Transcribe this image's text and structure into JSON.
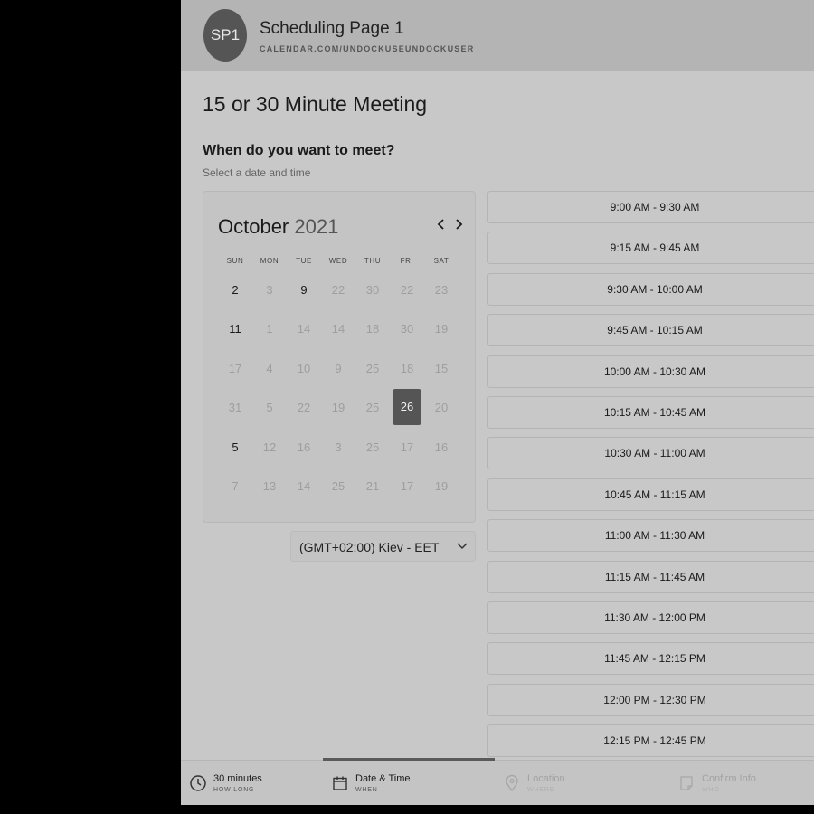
{
  "header": {
    "avatar_initials": "SP1",
    "title": "Scheduling Page 1",
    "url": "CALENDAR.COM/UNDOCKUSEUNDOCKUSER"
  },
  "meeting_title": "15 or 30 Minute Meeting",
  "question": "When do you want to meet?",
  "subtitle": "Select a date and time",
  "calendar": {
    "month": "October",
    "year": "2021",
    "weekdays": [
      "SUN",
      "MON",
      "TUE",
      "WED",
      "THU",
      "FRI",
      "SAT"
    ],
    "weeks": [
      [
        {
          "d": "2",
          "on": true
        },
        {
          "d": "3"
        },
        {
          "d": "9",
          "on": true
        },
        {
          "d": "22"
        },
        {
          "d": "30"
        },
        {
          "d": "22"
        },
        {
          "d": "23"
        }
      ],
      [
        {
          "d": "11",
          "on": true
        },
        {
          "d": "1"
        },
        {
          "d": "14"
        },
        {
          "d": "14"
        },
        {
          "d": "18"
        },
        {
          "d": "30"
        },
        {
          "d": "19"
        }
      ],
      [
        {
          "d": "17"
        },
        {
          "d": "4"
        },
        {
          "d": "10"
        },
        {
          "d": "9"
        },
        {
          "d": "25"
        },
        {
          "d": "18"
        },
        {
          "d": "15"
        }
      ],
      [
        {
          "d": "31"
        },
        {
          "d": "5"
        },
        {
          "d": "22"
        },
        {
          "d": "19"
        },
        {
          "d": "25"
        },
        {
          "d": "26",
          "sel": true
        },
        {
          "d": "20"
        }
      ],
      [
        {
          "d": "5",
          "on": true
        },
        {
          "d": "12"
        },
        {
          "d": "16"
        },
        {
          "d": "3"
        },
        {
          "d": "25"
        },
        {
          "d": "17"
        },
        {
          "d": "16"
        }
      ],
      [
        {
          "d": "7"
        },
        {
          "d": "13"
        },
        {
          "d": "14"
        },
        {
          "d": "25"
        },
        {
          "d": "21"
        },
        {
          "d": "17"
        },
        {
          "d": "19"
        }
      ]
    ]
  },
  "timezone": "(GMT+02:00) Kiev - EET",
  "time_slots": [
    "9:00 AM - 9:30 AM",
    "9:15 AM - 9:45 AM",
    "9:30 AM - 10:00 AM",
    "9:45 AM - 10:15 AM",
    "10:00 AM - 10:30 AM",
    "10:15 AM - 10:45 AM",
    "10:30 AM - 11:00 AM",
    "10:45 AM - 11:15 AM",
    "11:00 AM - 11:30 AM",
    "11:15 AM - 11:45 AM",
    "11:30 AM - 12:00 PM",
    "11:45 AM - 12:15 PM",
    "12:00 PM - 12:30 PM",
    "12:15 PM - 12:45 PM"
  ],
  "steps": [
    {
      "title": "30 minutes",
      "sub": "HOW LONG",
      "icon": "clock-icon",
      "state": "done"
    },
    {
      "title": "Date & Time",
      "sub": "WHEN",
      "icon": "calendar-icon",
      "state": "active"
    },
    {
      "title": "Location",
      "sub": "WHERE",
      "icon": "location-pin-icon",
      "state": "pending"
    },
    {
      "title": "Confirm Info",
      "sub": "WHO",
      "icon": "document-icon",
      "state": "pending"
    }
  ]
}
